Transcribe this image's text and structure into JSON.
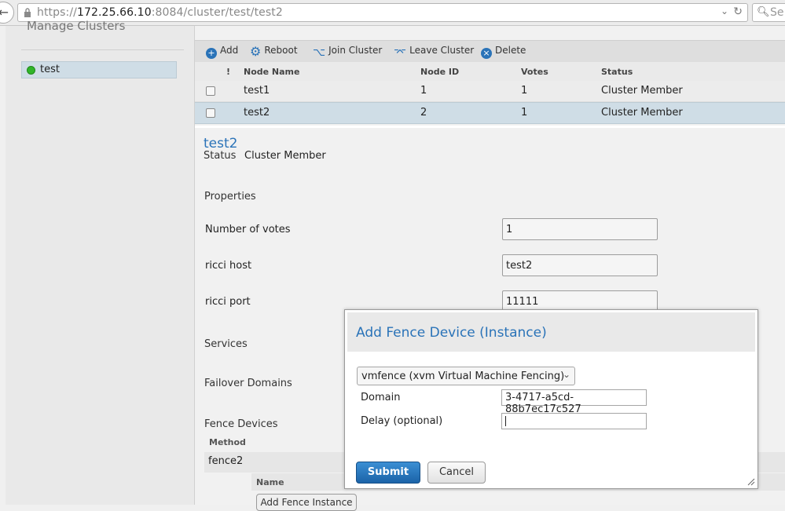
{
  "browser": {
    "url_prefix": "https://",
    "url_host": "172.25.66.10",
    "url_rest": ":8084/cluster/test/test2",
    "search_placeholder": "Se"
  },
  "sidebar": {
    "heading": "Manage Clusters",
    "clusters": [
      {
        "label": "test",
        "status_color": "#31b52a"
      }
    ]
  },
  "toolbar": {
    "add": "Add",
    "reboot": "Reboot",
    "join": "Join Cluster",
    "leave": "Leave Cluster",
    "delete": "Delete"
  },
  "nodes_table": {
    "headers": {
      "flag": "!",
      "name": "Node Name",
      "id": "Node ID",
      "votes": "Votes",
      "status": "Status"
    },
    "rows": [
      {
        "name": "test1",
        "id": "1",
        "votes": "1",
        "status": "Cluster Member",
        "selected": false
      },
      {
        "name": "test2",
        "id": "2",
        "votes": "1",
        "status": "Cluster Member",
        "selected": true
      }
    ]
  },
  "node": {
    "title": "test2",
    "status_label": "Status",
    "status_value": "Cluster Member",
    "properties_heading": "Properties",
    "votes_label": "Number of votes",
    "votes_value": "1",
    "ricci_host_label": "ricci host",
    "ricci_host_value": "test2",
    "ricci_port_label": "ricci port",
    "ricci_port_value": "11111",
    "services_heading": "Services",
    "failover_heading": "Failover Domains",
    "fence_heading": "Fence Devices",
    "method_header": "Method",
    "method_name": "fence2",
    "name_header": "Name",
    "add_fence_instance": "Add Fence Instance"
  },
  "modal": {
    "title": "Add Fence Device (Instance)",
    "device_selected": "vmfence (xvm Virtual Machine Fencing)",
    "domain_label": "Domain",
    "domain_value": "3-4717-a5cd-88b7ec17c527",
    "delay_label": "Delay (optional)",
    "delay_value": "",
    "submit": "Submit",
    "cancel": "Cancel"
  },
  "colors": {
    "accent": "#2a73b8",
    "selected_row": "#cfdde6",
    "status_ok": "#31b52a"
  }
}
